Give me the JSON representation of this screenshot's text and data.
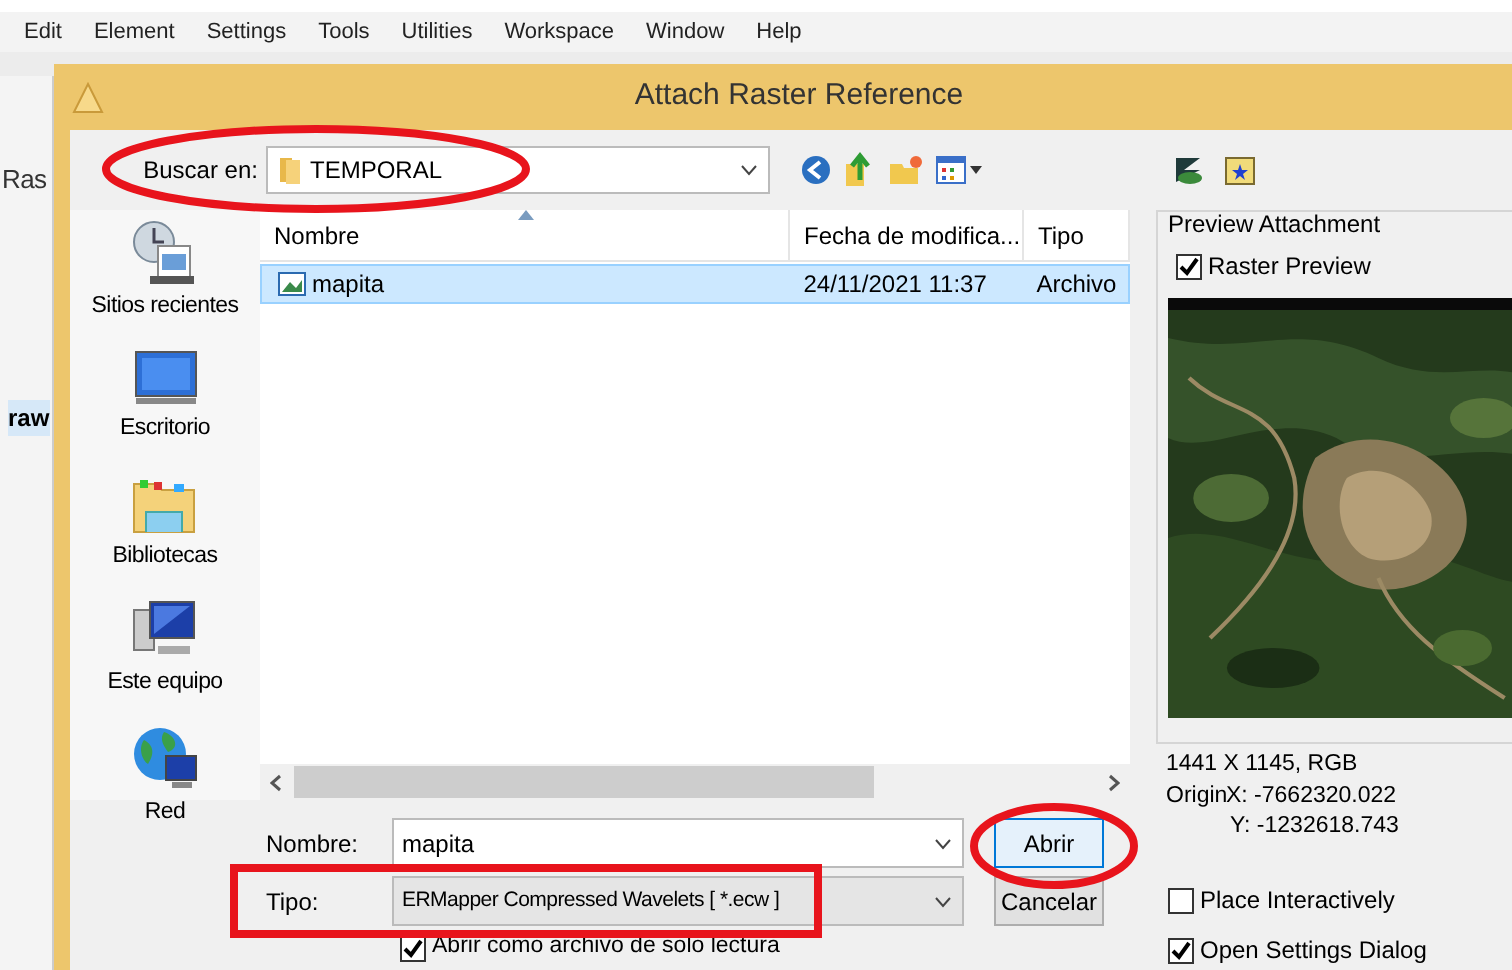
{
  "menu": [
    "Edit",
    "Element",
    "Settings",
    "Tools",
    "Utilities",
    "Workspace",
    "Window",
    "Help"
  ],
  "background_app": {
    "labels": [
      "Ras",
      "raw"
    ]
  },
  "dialog": {
    "title": "Attach Raster Reference",
    "look_in": {
      "label": "Buscar en:",
      "value": "TEMPORAL"
    },
    "places": [
      {
        "label": "Sitios recientes",
        "kind": "recent"
      },
      {
        "label": "Escritorio",
        "kind": "desktop"
      },
      {
        "label": "Bibliotecas",
        "kind": "libraries"
      },
      {
        "label": "Este equipo",
        "kind": "computer"
      },
      {
        "label": "Red",
        "kind": "network"
      }
    ],
    "columns": [
      "Nombre",
      "Fecha de modifica...",
      "Tipo"
    ],
    "files": [
      {
        "name": "mapita",
        "modified": "24/11/2021 11:37",
        "type": "Archivo",
        "selected": true
      }
    ],
    "file_name": {
      "label": "Nombre:",
      "value": "mapita"
    },
    "file_type": {
      "label": "Tipo:",
      "value": "ERMapper Compressed Wavelets [ *.ecw ]"
    },
    "read_only": {
      "label": "Abrir como archivo de solo lectura",
      "checked": true
    },
    "buttons": [
      {
        "label": "Abrir",
        "default": true
      },
      {
        "label": "Cancelar",
        "default": false
      }
    ],
    "preview": {
      "title": "Preview Attachment",
      "raster_preview": {
        "label": "Raster Preview",
        "checked": true
      },
      "info": "1441 X 1145, RGB",
      "origin_label": "Origin",
      "origin_x": "X: -7662320.022",
      "origin_y": "Y: -1232618.743"
    },
    "options": [
      {
        "label": "Place Interactively",
        "checked": false
      },
      {
        "label": "Open Settings Dialog",
        "checked": true
      }
    ]
  }
}
